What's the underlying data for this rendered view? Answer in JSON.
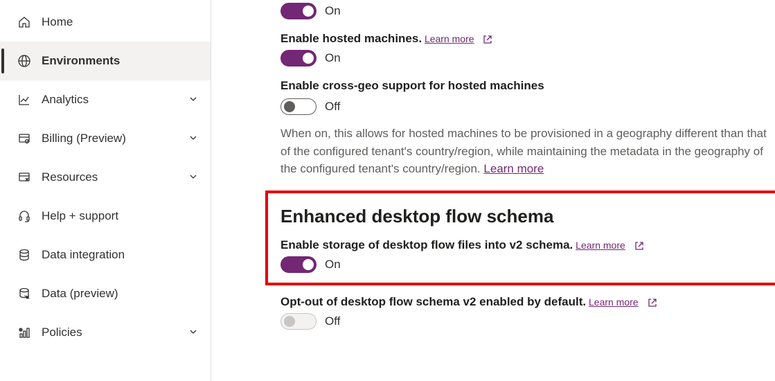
{
  "sidebar": {
    "items": [
      {
        "label": "Home"
      },
      {
        "label": "Environments"
      },
      {
        "label": "Analytics"
      },
      {
        "label": "Billing (Preview)"
      },
      {
        "label": "Resources"
      },
      {
        "label": "Help + support"
      },
      {
        "label": "Data integration"
      },
      {
        "label": "Data (preview)"
      },
      {
        "label": "Policies"
      }
    ]
  },
  "main": {
    "toggle_on_label": "On",
    "toggle_off_label": "Off",
    "learn_more": "Learn more",
    "settings": {
      "hosted_machines_label": "Enable hosted machines.",
      "cross_geo_label": "Enable cross-geo support for hosted machines",
      "cross_geo_desc_1": "When on, this allows for hosted machines to be provisioned in a geography different than that of the configured tenant's country/region, while maintaining the metadata in the geography of the configured tenant's country/region.",
      "cross_geo_learn": "Learn more",
      "schema_section_title": "Enhanced desktop flow schema",
      "schema_enable_label": "Enable storage of desktop flow files into v2 schema.",
      "schema_optout_label": "Opt-out of desktop flow schema v2 enabled by default."
    }
  }
}
